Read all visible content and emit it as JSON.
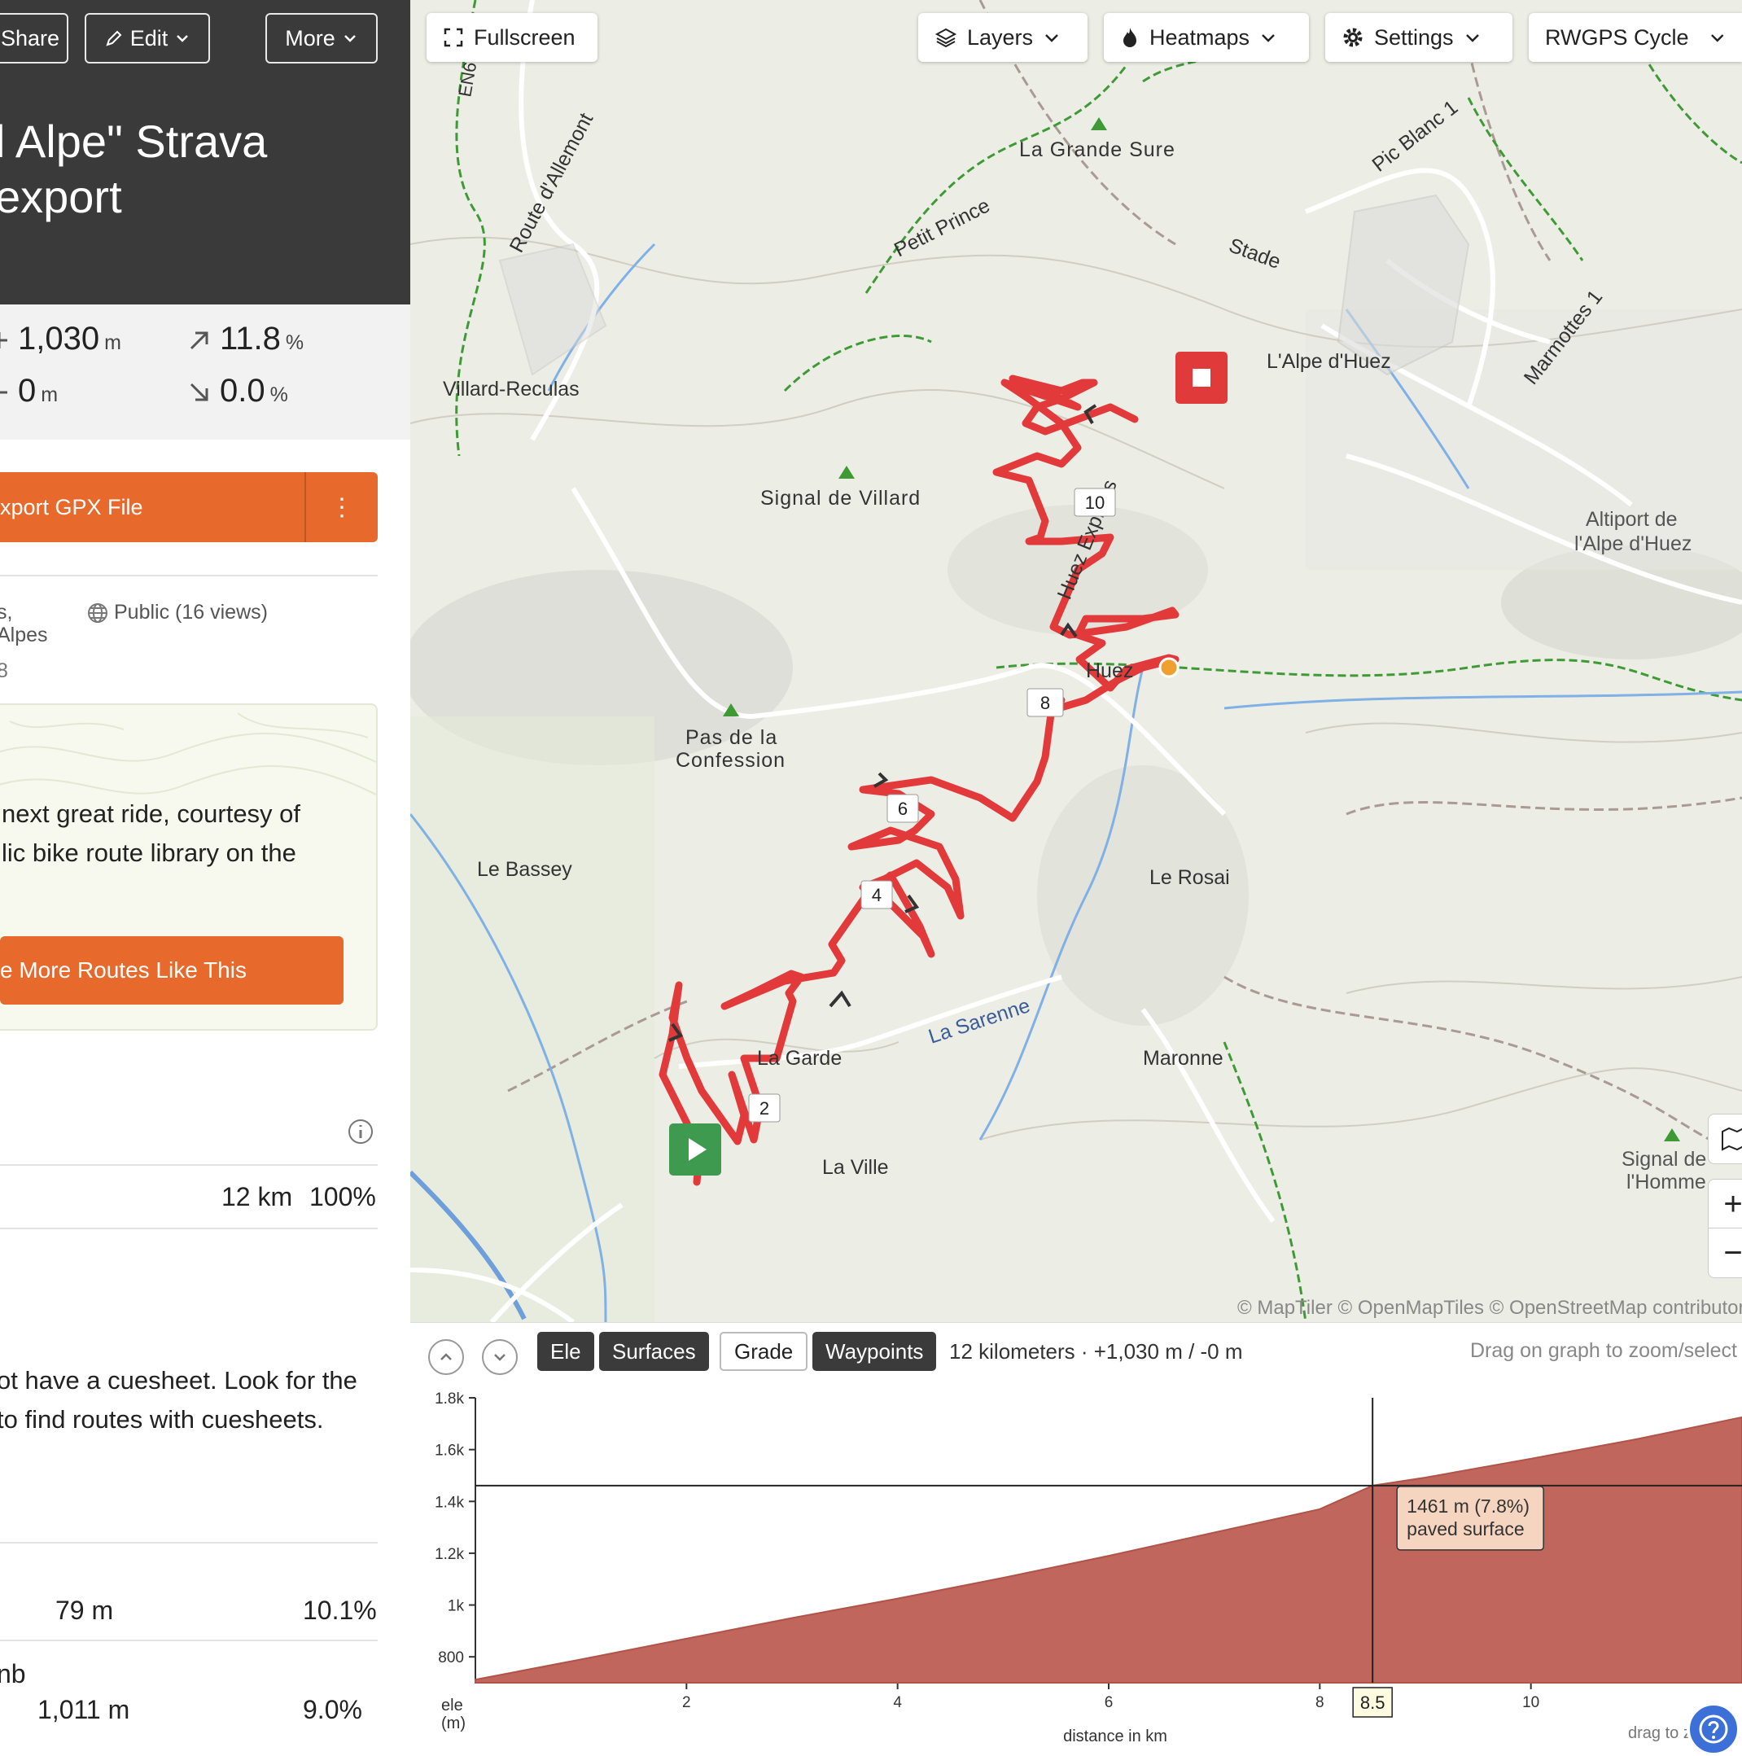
{
  "header": {
    "share_label": "Share",
    "edit_label": "Edit",
    "more_label": "More",
    "title_line1": "l Alpe\" Strava",
    "title_line2": "export"
  },
  "stats": {
    "elevation_gain": "1,030",
    "elevation_gain_unit": "m",
    "elevation_loss": "0",
    "elevation_loss_unit": "m",
    "max_grade": "11.8",
    "max_grade_unit": "%",
    "min_grade": "0.0",
    "min_grade_unit": "%"
  },
  "export": {
    "label": "xport GPX File",
    "menu_icon": "⋮"
  },
  "meta": {
    "location_line1": "s,",
    "location_line2": "Alpes",
    "location_line3": "8",
    "visibility": "Public (16 views)"
  },
  "promo": {
    "line1": "next great ride, courtesy of",
    "line2": "lic bike route library on the",
    "button_label": "e More Routes Like This"
  },
  "surfaces": {
    "paved_distance": "12 km",
    "paved_percent": "100%"
  },
  "cuesheet": {
    "line1": "ot have a cuesheet. Look for the",
    "line2": "to find routes with cuesheets."
  },
  "climbs": [
    {
      "label": "",
      "value": "79 m",
      "percent": "10.1%"
    },
    {
      "label": "nb",
      "value": "1,011 m",
      "percent": "9.0%"
    }
  ],
  "map": {
    "buttons": {
      "fullscreen": "Fullscreen",
      "layers": "Layers",
      "heatmaps": "Heatmaps",
      "settings": "Settings",
      "basemap": "RWGPS Cycle"
    },
    "labels": {
      "la_grande_sure": "La Grande Sure",
      "pic_blanc": "Pic Blanc 1",
      "route_allemont": "Route d'Allemont",
      "petit_prince": "Petit Prince",
      "stade": "Stade",
      "marmottes": "Marmottes 1",
      "lalpe_dhuez": "L'Alpe d'Huez",
      "villard_reculas": "Villard-Reculas",
      "signal_villard": "Signal de Villard",
      "huez_express": "Huez Express",
      "altiport1": "Altiport de",
      "altiport2": "l'Alpe d'Huez",
      "huez": "Huez",
      "pas_confession1": "Pas de la",
      "pas_confession2": "Confession",
      "le_bassey": "Le Bassey",
      "le_rosai": "Le Rosai",
      "la_garde": "La Garde",
      "la_sarenne": "La Sarenne",
      "maronne": "Maronne",
      "la_ville": "La Ville",
      "signal_homme1": "Signal de",
      "signal_homme2": "l'Homme",
      "road_en": "EN6"
    },
    "km_markers": [
      "2",
      "4",
      "6",
      "8",
      "10"
    ],
    "attribution": "© MapTiler © OpenMapTiles © OpenStreetMap contributors"
  },
  "elevation": {
    "tabs": {
      "ele": "Ele",
      "surfaces": "Surfaces",
      "grade": "Grade",
      "waypoints": "Waypoints"
    },
    "summary": "12 kilometers · +1,030 m / -0 m",
    "hint": "Drag on graph to zoom/select",
    "y_ticks": [
      "1.8k",
      "1.6k",
      "1.4k",
      "1.2k",
      "1k",
      "800"
    ],
    "x_ticks": [
      "2",
      "4",
      "6",
      "8",
      "10"
    ],
    "y_label1": "ele",
    "y_label2": "(m)",
    "x_label": "distance in km",
    "hint_bottom": "drag to zoom in",
    "cursor_km": "8.5",
    "tooltip_line1": "1461 m (7.8%)",
    "tooltip_line2": "paved surface",
    "fill_color": "#c1665c"
  },
  "chart_data": {
    "type": "area",
    "xlabel": "distance in km",
    "ylabel": "ele (m)",
    "xlim": [
      0,
      12
    ],
    "ylim": [
      700,
      1800
    ],
    "x": [
      0,
      1,
      2,
      3,
      4,
      5,
      6,
      7,
      8,
      8.5,
      9,
      10,
      11,
      12
    ],
    "values": [
      712,
      790,
      870,
      950,
      1025,
      1105,
      1190,
      1280,
      1370,
      1461,
      1492,
      1565,
      1640,
      1725
    ]
  }
}
